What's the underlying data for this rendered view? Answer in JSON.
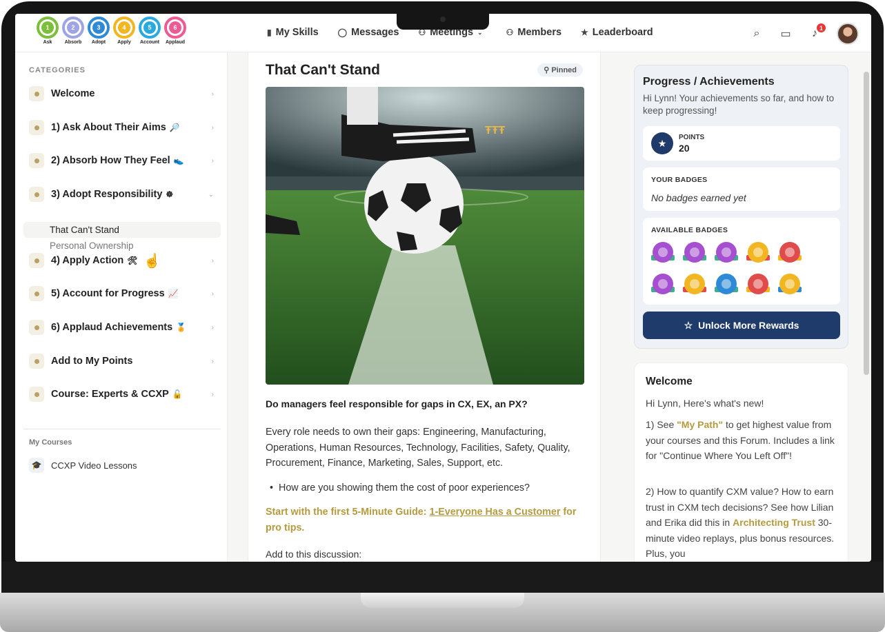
{
  "logo": {
    "steps": [
      {
        "num": "1",
        "caption": "Ask",
        "color": "#7bbf3a"
      },
      {
        "num": "2",
        "caption": "Absorb",
        "color": "#9fa4e6"
      },
      {
        "num": "3",
        "caption": "Adopt",
        "color": "#2e8ad6"
      },
      {
        "num": "4",
        "caption": "Apply",
        "color": "#f2b623"
      },
      {
        "num": "5",
        "caption": "Account",
        "color": "#2aa9de"
      },
      {
        "num": "6",
        "caption": "Applaud",
        "color": "#ee5a93"
      }
    ]
  },
  "nav": {
    "items": [
      {
        "label": "My Skills",
        "icon": "bar-chart-icon"
      },
      {
        "label": "Messages",
        "icon": "chat-bubble-icon"
      },
      {
        "label": "Meetings",
        "icon": "people-icon"
      },
      {
        "label": "Members",
        "icon": "members-icon"
      },
      {
        "label": "Leaderboard",
        "icon": "star-icon"
      }
    ],
    "notification_count": "1"
  },
  "sidebar": {
    "title": "CATEGORIES",
    "items": [
      {
        "label": "Welcome",
        "emoji": ""
      },
      {
        "label": "1) Ask About Their Aims",
        "emoji": "🔎"
      },
      {
        "label": "2) Absorb How They Feel",
        "emoji": "👟"
      },
      {
        "label": "3) Adopt Responsibility",
        "emoji": "☸"
      },
      {
        "label": "4) Apply Action",
        "emoji": "🛠"
      },
      {
        "label": "5) Account for Progress",
        "emoji": "📈"
      },
      {
        "label": "6) Applaud Achievements",
        "emoji": "🏅"
      },
      {
        "label": "Add to My Points",
        "emoji": ""
      },
      {
        "label": "Course: Experts & CCXP",
        "emoji": "🔓"
      }
    ],
    "subitems": [
      "That Can't Stand",
      "Personal Ownership"
    ],
    "my_courses_label": "My Courses",
    "course": "CCXP Video Lessons"
  },
  "post": {
    "title": "That Can't Stand",
    "pinned": "Pinned",
    "question": "Do managers feel responsible for gaps in CX, EX, an PX?",
    "paragraph": "Every role needs to own their gaps: Engineering, Manufacturing, Operations, Human Resources, Technology, Facilities, Safety, Quality, Procurement, Finance, Marketing, Sales, Support, etc.",
    "bullet": "How are you showing them the cost of poor experiences?",
    "cta_start": "Start with the first 5-Minute Guide: ",
    "cta_link": "1-Everyone Has a Customer",
    "cta_end": " for pro tips.",
    "add": "Add to this discussion:"
  },
  "achievements": {
    "title": "Progress / Achievements",
    "subtitle": "Hi Lynn! Your achievements so far, and how to keep progressing!",
    "points_label": "POINTS",
    "points_value": "20",
    "your_badges_label": "YOUR BADGES",
    "your_badges_empty": "No badges earned yet",
    "available_label": "AVAILABLE BADGES",
    "badges": [
      {
        "color": "#a64fd0",
        "ribbon": "#3fae8a"
      },
      {
        "color": "#a64fd0",
        "ribbon": "#3fae8a"
      },
      {
        "color": "#a64fd0",
        "ribbon": "#3fae8a"
      },
      {
        "color": "#f2b623",
        "ribbon": "#e04b4b"
      },
      {
        "color": "#e04b4b",
        "ribbon": "#f2b623"
      },
      {
        "color": "#a64fd0",
        "ribbon": "#3fae8a"
      },
      {
        "color": "#f2b623",
        "ribbon": "#e04b4b"
      },
      {
        "color": "#2e8ad6",
        "ribbon": "#3fae8a"
      },
      {
        "color": "#e04b4b",
        "ribbon": "#f2b623"
      },
      {
        "color": "#f2b623",
        "ribbon": "#2e8ad6"
      }
    ],
    "unlock_label": "Unlock More Rewards"
  },
  "welcome": {
    "title": "Welcome",
    "greeting": "Hi Lynn, Here's what's new!",
    "item1_pre": "1) See ",
    "item1_link": "\"My Path\"",
    "item1_post": " to get highest value from your courses and this Forum. Includes a link for \"Continue Where You Left Off\"!",
    "item2_pre": "2) How to quantify CXM value? How to earn trust in CXM tech decisions? See how Lilian and Erika did this in ",
    "item2_link": "Architecting Trust",
    "item2_post": " 30-minute video replays, plus bonus resources. Plus, you"
  }
}
